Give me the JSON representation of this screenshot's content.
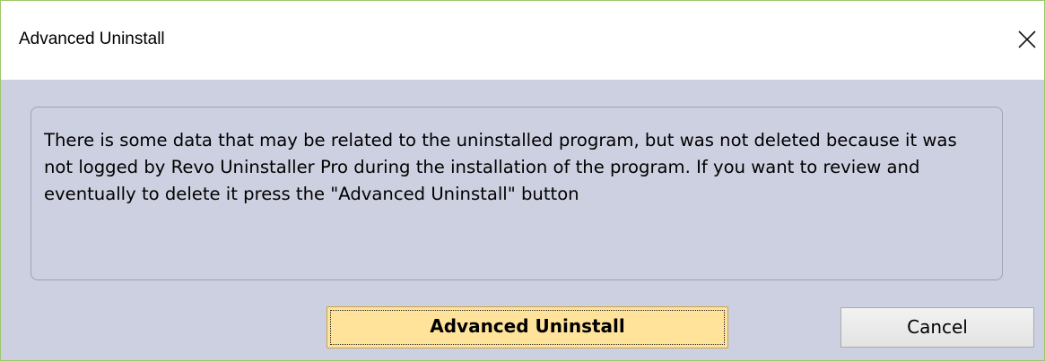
{
  "window": {
    "title": "Advanced Uninstall"
  },
  "dialog": {
    "message": "There is some data that may be related to the uninstalled program, but was not deleted because it was not logged by Revo Uninstaller Pro during the installation of the program. If you want to review and eventually to delete it press the \"Advanced Uninstall\" button",
    "advanced_button_label": "Advanced Uninstall",
    "cancel_button_label": "Cancel"
  },
  "colors": {
    "client_background": "#cdd0e0",
    "primary_button": "#ffe39a",
    "window_border": "#9bc96b"
  },
  "icons": {
    "close": "close-icon"
  }
}
